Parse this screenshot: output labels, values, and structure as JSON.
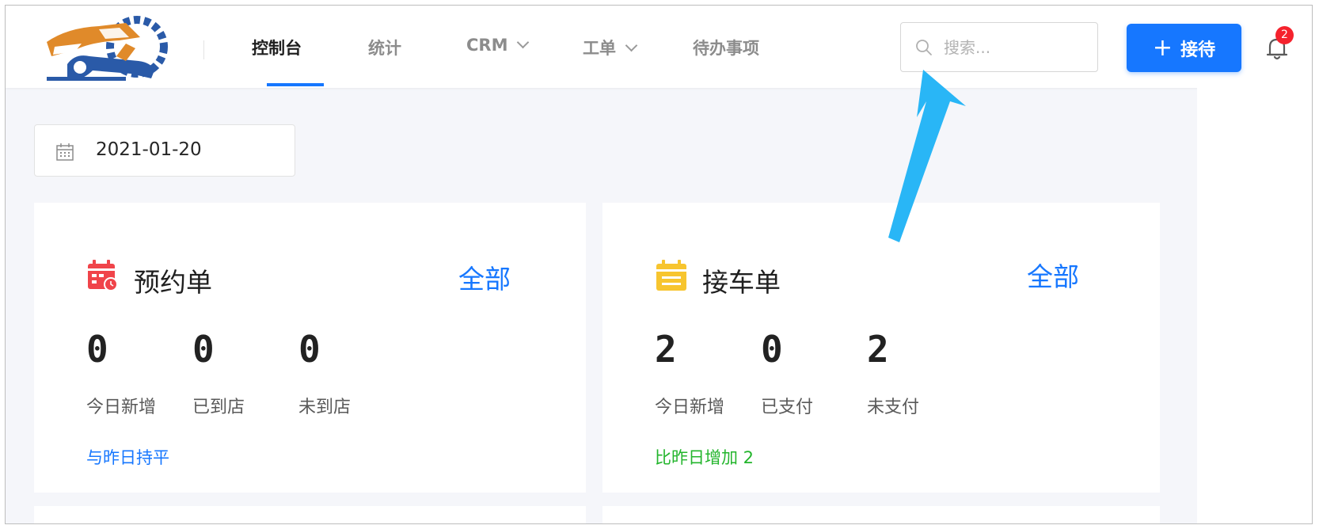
{
  "nav": {
    "items": [
      {
        "label": "控制台",
        "active": true,
        "has_dropdown": false
      },
      {
        "label": "统计",
        "active": false,
        "has_dropdown": false
      },
      {
        "label": "CRM",
        "active": false,
        "has_dropdown": true
      },
      {
        "label": "工单",
        "active": false,
        "has_dropdown": true
      },
      {
        "label": "待办事项",
        "active": false,
        "has_dropdown": false
      }
    ]
  },
  "search": {
    "placeholder": "搜索..."
  },
  "reception_button": {
    "label": "接待",
    "icon": "plus-icon"
  },
  "notifications": {
    "count": "2",
    "icon": "bell-icon"
  },
  "date_picker": {
    "value": "2021-01-20",
    "icon": "calendar-icon"
  },
  "cards": [
    {
      "title": "预约单",
      "icon": "calendar-clock-icon",
      "link": "全部",
      "stats": [
        {
          "value": "0",
          "label": "今日新增"
        },
        {
          "value": "0",
          "label": "已到店"
        },
        {
          "value": "0",
          "label": "未到店"
        }
      ],
      "note": "与昨日持平"
    },
    {
      "title": "接车单",
      "icon": "document-icon",
      "link": "全部",
      "stats": [
        {
          "value": "2",
          "label": "今日新增"
        },
        {
          "value": "0",
          "label": "已支付"
        },
        {
          "value": "2",
          "label": "未支付"
        }
      ],
      "note": "比昨日增加 2"
    }
  ],
  "colors": {
    "accent": "#1677ff",
    "positive": "#23b52c",
    "badge": "#f5222d",
    "annotation_arrow": "#29b6f6",
    "logo_orange": "#e08a2a",
    "logo_blue": "#2a5aa8"
  }
}
